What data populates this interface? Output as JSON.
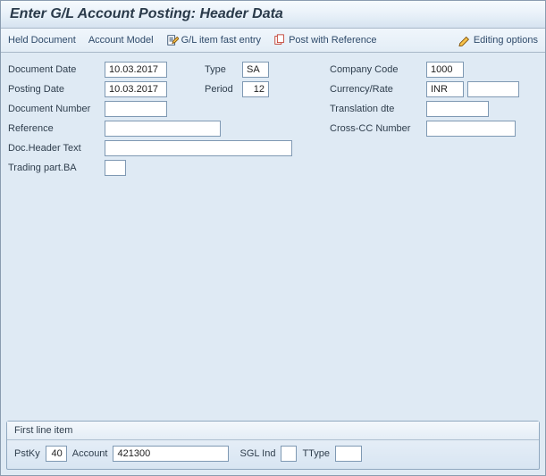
{
  "title": "Enter G/L Account Posting: Header Data",
  "toolbar": {
    "held_document": "Held Document",
    "account_model": "Account Model",
    "gl_fast_entry": "G/L item fast entry",
    "post_with_reference": "Post with Reference",
    "editing_options": "Editing options"
  },
  "fields": {
    "document_date_label": "Document Date",
    "document_date": "10.03.2017",
    "posting_date_label": "Posting Date",
    "posting_date": "10.03.2017",
    "document_number_label": "Document Number",
    "document_number": "",
    "reference_label": "Reference",
    "reference": "",
    "doc_header_text_label": "Doc.Header Text",
    "doc_header_text": "",
    "trading_part_ba_label": "Trading part.BA",
    "trading_part_ba": "",
    "type_label": "Type",
    "type": "SA",
    "period_label": "Period",
    "period": "12",
    "company_code_label": "Company Code",
    "company_code": "1000",
    "currency_rate_label": "Currency/Rate",
    "currency": "INR",
    "rate": "",
    "translation_dte_label": "Translation dte",
    "translation_dte": "",
    "cross_cc_number_label": "Cross-CC Number",
    "cross_cc_number": ""
  },
  "line_item": {
    "panel_title": "First line item",
    "pstky_label": "PstKy",
    "pstky": "40",
    "account_label": "Account",
    "account": "421300",
    "sgl_ind_label": "SGL Ind",
    "sgl_ind": "",
    "ttype_label": "TType",
    "ttype": ""
  }
}
